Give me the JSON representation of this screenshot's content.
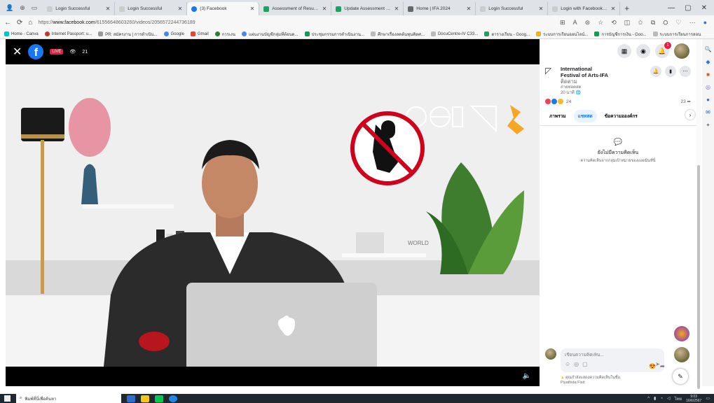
{
  "browser": {
    "tabs": [
      {
        "title": "Login Successful",
        "active": false
      },
      {
        "title": "Login Successful",
        "active": false
      },
      {
        "title": "(3) Facebook",
        "active": true
      },
      {
        "title": "Assessment of Result Writ",
        "active": false
      },
      {
        "title": "Update Assessment of Re",
        "active": false
      },
      {
        "title": "Home | IFA 2024",
        "active": false
      },
      {
        "title": "Login Successful",
        "active": false
      },
      {
        "title": "Login with Facebook - Zoo",
        "active": false
      }
    ],
    "url_prefix": "https://",
    "url_domain": "www.facebook.com",
    "url_path": "/61556648603260/videos/2056572244736189",
    "bookmarks": [
      "Home - Canva",
      "Internet Passport: u...",
      "PR: สมัครงาน | การดำเนิน...",
      "Google",
      "Gmail",
      "การเงน",
      "แผ่นงานบัญชีกลุ่มที่ต้อนด...",
      "ประชุมกรรมการดำเนินงาน...",
      "ศึกษาเรื่องลดต้นทุนคิดศ...",
      "DocuCentre-IV C33...",
      "ตารางเรียน - Goog...",
      "ระบบการเรียนออนไลน์...",
      "การบัญชีการเงิน - Goo...",
      "ระบบการเรียนการสอน"
    ]
  },
  "viewer": {
    "live_label": "LIVE",
    "viewer_count": "21",
    "close_label": "✕"
  },
  "panel": {
    "page_name": "International Festival of Arts-IFA",
    "follow_label": "ติดตาม",
    "post_subtitle": "ถ่ายทอดสด",
    "post_time": "20 นาที",
    "reaction_count": "24",
    "share_count": "23",
    "tabs": [
      "ภาพรวม",
      "แชทสด",
      "ข้อความอองค์กร"
    ],
    "empty_title": "ยังไม่มีความคิดเห็น",
    "empty_subtitle": "ความคิดเห็นจากกลุ่มเป้าหมายของแอดมินที่นี่",
    "composer_placeholder": "เขียนความคิดเห็น...",
    "composer_note": "คุณกำลังแสดงความคิดเห็นในชื่อ",
    "composer_note_name": "Piyathida Fisit"
  },
  "taskbar": {
    "search_placeholder": "พิมพ์ที่นี่เพื่อค้นหา",
    "time": "9:03",
    "date": "16/6/2567",
    "lang": "ไทย"
  },
  "colors": {
    "facebook_blue": "#1877f2",
    "live_red": "#e41e3f",
    "taskbar": "#1f2730"
  }
}
